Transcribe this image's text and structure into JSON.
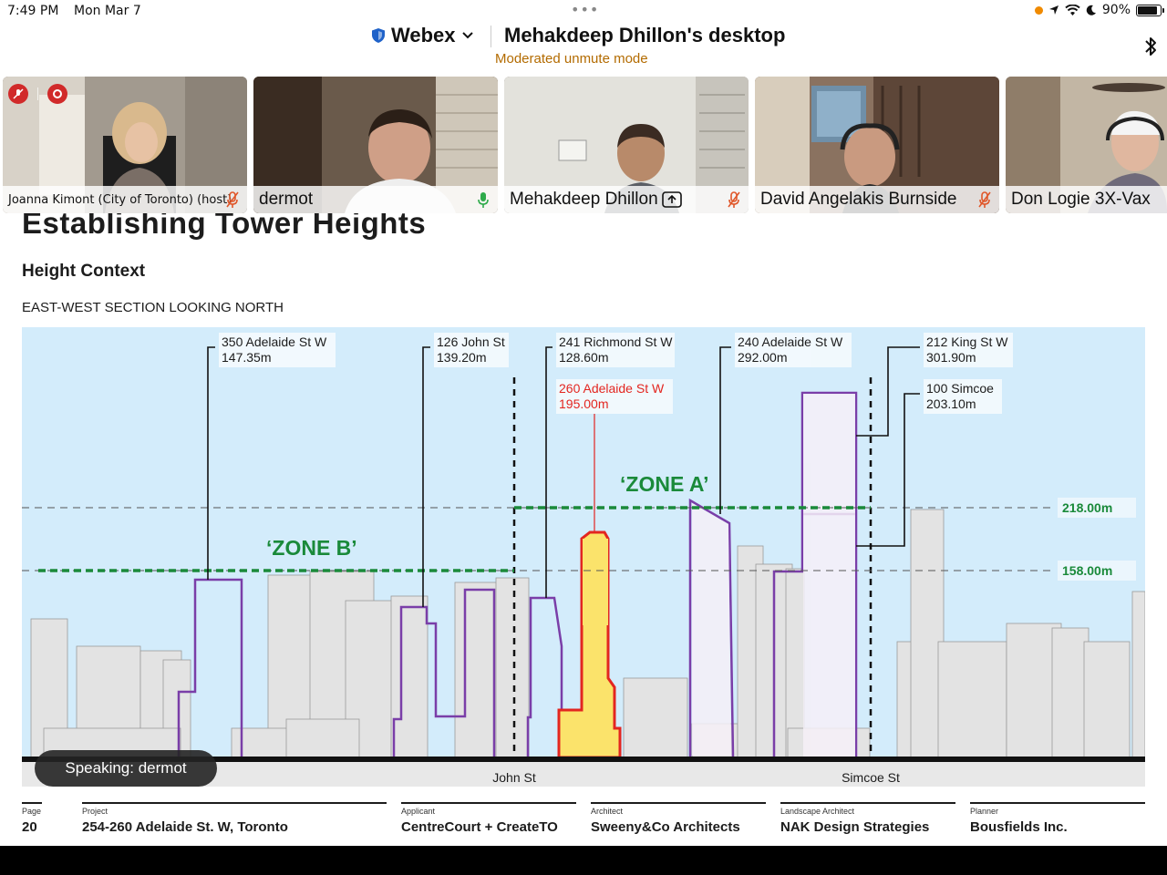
{
  "status_bar": {
    "time": "7:49 PM",
    "date": "Mon Mar 7",
    "battery": "90%",
    "battery_fraction": 0.9
  },
  "webex": {
    "brand": "Webex",
    "share_title": "Mehakdeep Dhillon's desktop",
    "mode": "Moderated unmute mode"
  },
  "participants": [
    {
      "name": "Joanna Kimont (City of Toronto) (host)",
      "mic": "muted"
    },
    {
      "name": "dermot",
      "mic": "active"
    },
    {
      "name": "Mehakdeep Dhillon",
      "mic": "muted",
      "sharing": true
    },
    {
      "name": "David Angelakis Burnside",
      "mic": "muted"
    },
    {
      "name": "Don Logie 3X-Vax",
      "mic": "none"
    }
  ],
  "slide": {
    "title": "Establishing Tower Heights",
    "subtitle": "Height Context",
    "section": "EAST-WEST SECTION LOOKING NORTH",
    "zone_a": "‘ZONE A’",
    "zone_b": "‘ZONE B’",
    "level_218": "218.00m",
    "level_158": "158.00m",
    "street_john": "John St",
    "street_simcoe": "Simcoe St",
    "callouts": [
      {
        "address": "350 Adelaide St W",
        "height": "147.35m"
      },
      {
        "address": "126 John St",
        "height": "139.20m"
      },
      {
        "address": "241 Richmond St W",
        "height": "128.60m"
      },
      {
        "address": "260 Adelaide St W",
        "height": "195.00m"
      },
      {
        "address": "240 Adelaide St W",
        "height": "292.00m"
      },
      {
        "address": "212 King St W",
        "height": "301.90m"
      },
      {
        "address": "100 Simcoe",
        "height": "203.10m"
      }
    ],
    "footer": {
      "page_label": "Page",
      "page_value": "20",
      "project_label": "Project",
      "project_value": "254-260 Adelaide St. W, Toronto",
      "applicant_label": "Applicant",
      "applicant_value": "CentreCourt + CreateTO",
      "architect_label": "Architect",
      "architect_value": "Sweeny&Co Architects",
      "landscape_label": "Landscape Architect",
      "landscape_value": "NAK Design Strategies",
      "planner_label": "Planner",
      "planner_value": "Bousfields Inc."
    }
  },
  "speaking": "Speaking: dermot",
  "colors": {
    "sky": "#d3ecfb",
    "outline_purple": "#7a3ea8",
    "subject_red": "#e32620",
    "subject_fill": "#fbe36b",
    "zone_green": "#1a8a3a"
  }
}
